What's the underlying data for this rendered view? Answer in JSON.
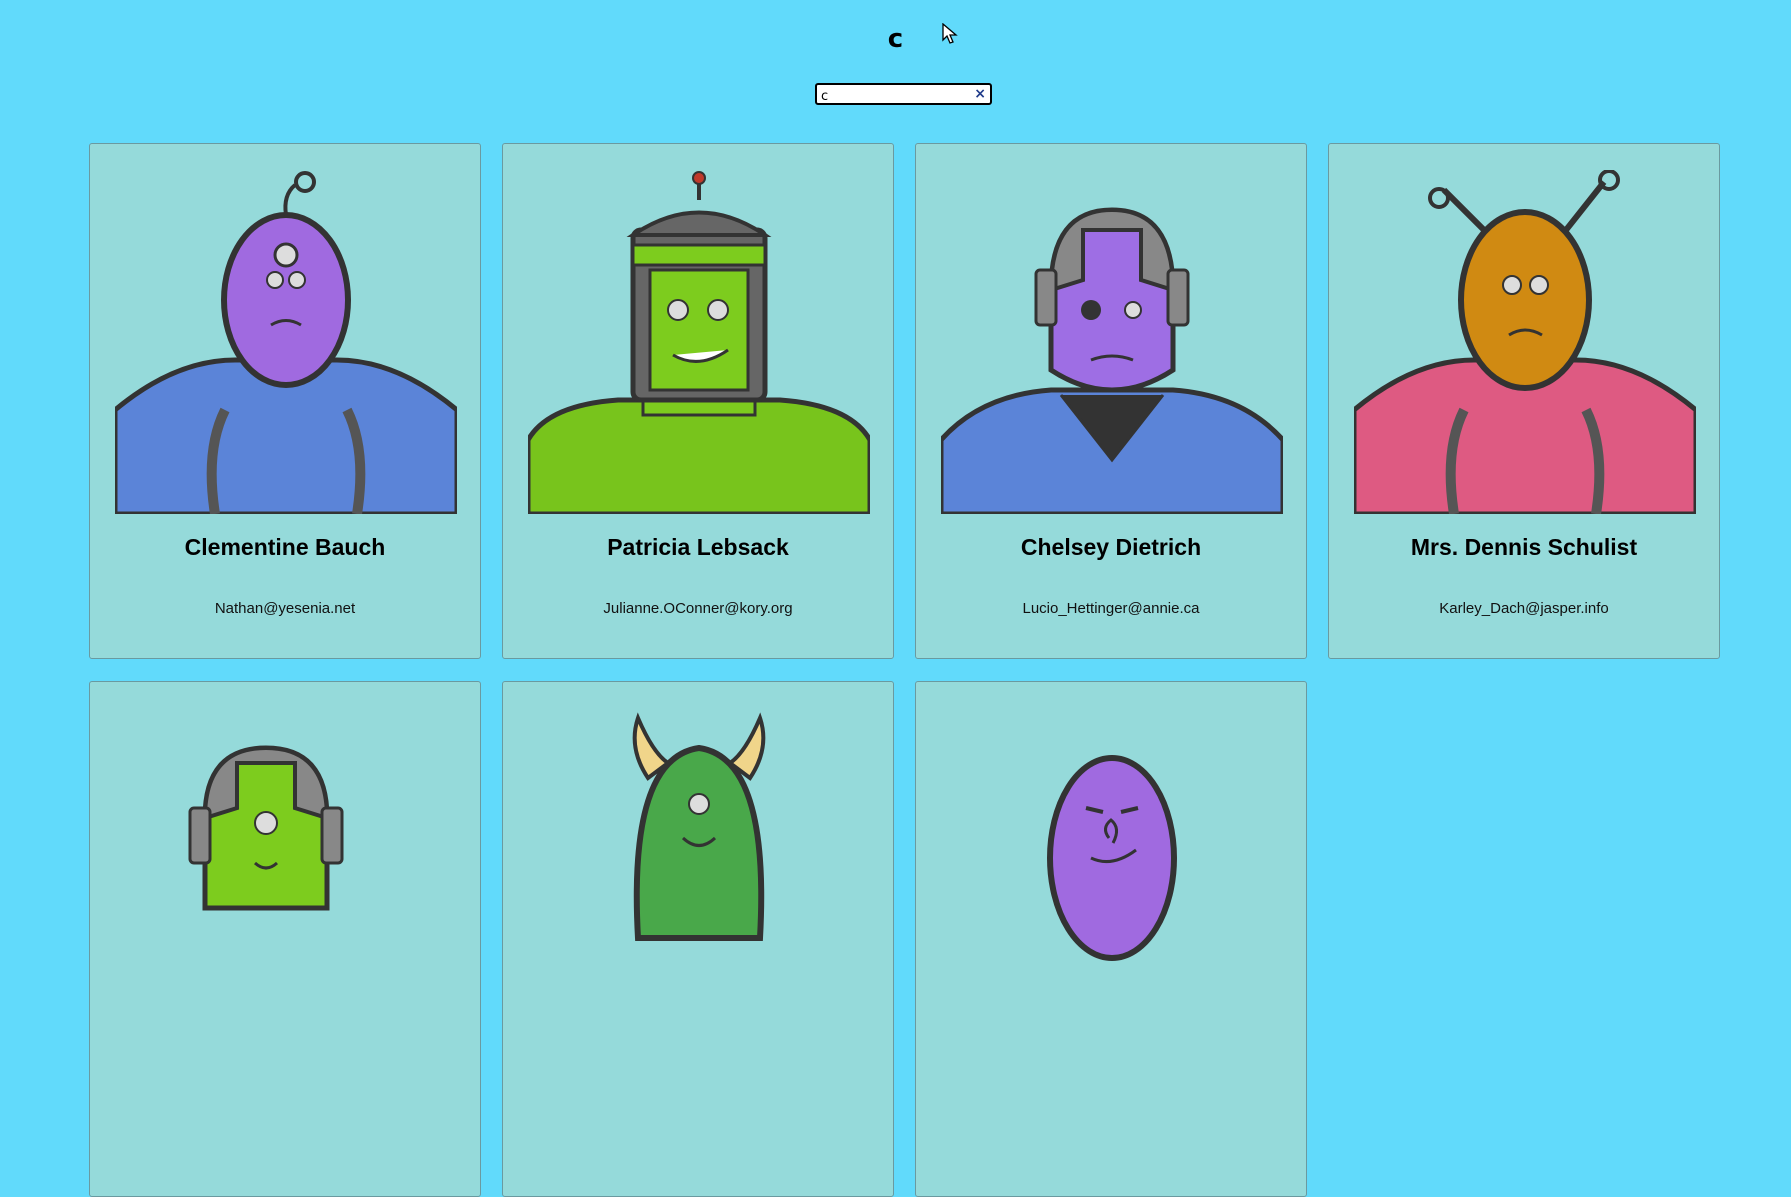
{
  "header": {
    "title": "c"
  },
  "search": {
    "value": "c",
    "clear_label": "×"
  },
  "cards": [
    {
      "name": "Clementine Bauch",
      "email": "Nathan@yesenia.net",
      "head_color": "#a06ae0",
      "body_color": "#5b84d8",
      "icon": "robot-avatar-purple-cyclops"
    },
    {
      "name": "Patricia Lebsack",
      "email": "Julianne.OConner@kory.org",
      "head_color": "#7dcc1e",
      "body_color": "#78c41c",
      "icon": "robot-avatar-green-helmet"
    },
    {
      "name": "Chelsey Dietrich",
      "email": "Lucio_Hettinger@annie.ca",
      "head_color": "#9e6ee4",
      "body_color": "#5b84d8",
      "icon": "robot-avatar-purple-spiked"
    },
    {
      "name": "Mrs. Dennis Schulist",
      "email": "Karley_Dach@jasper.info",
      "head_color": "#d08a12",
      "body_color": "#de5a82",
      "icon": "robot-avatar-orange-antenna"
    },
    {
      "name": "",
      "email": "",
      "head_color": "#7dcc1e",
      "body_color": "#5b84d8",
      "icon": "robot-avatar-green-helmet-small"
    },
    {
      "name": "",
      "email": "",
      "head_color": "#49a84a",
      "body_color": "#5b84d8",
      "icon": "robot-avatar-green-horned"
    },
    {
      "name": "",
      "email": "",
      "head_color": "#a06ae0",
      "body_color": "#5b84d8",
      "icon": "robot-avatar-purple-smirk"
    }
  ]
}
